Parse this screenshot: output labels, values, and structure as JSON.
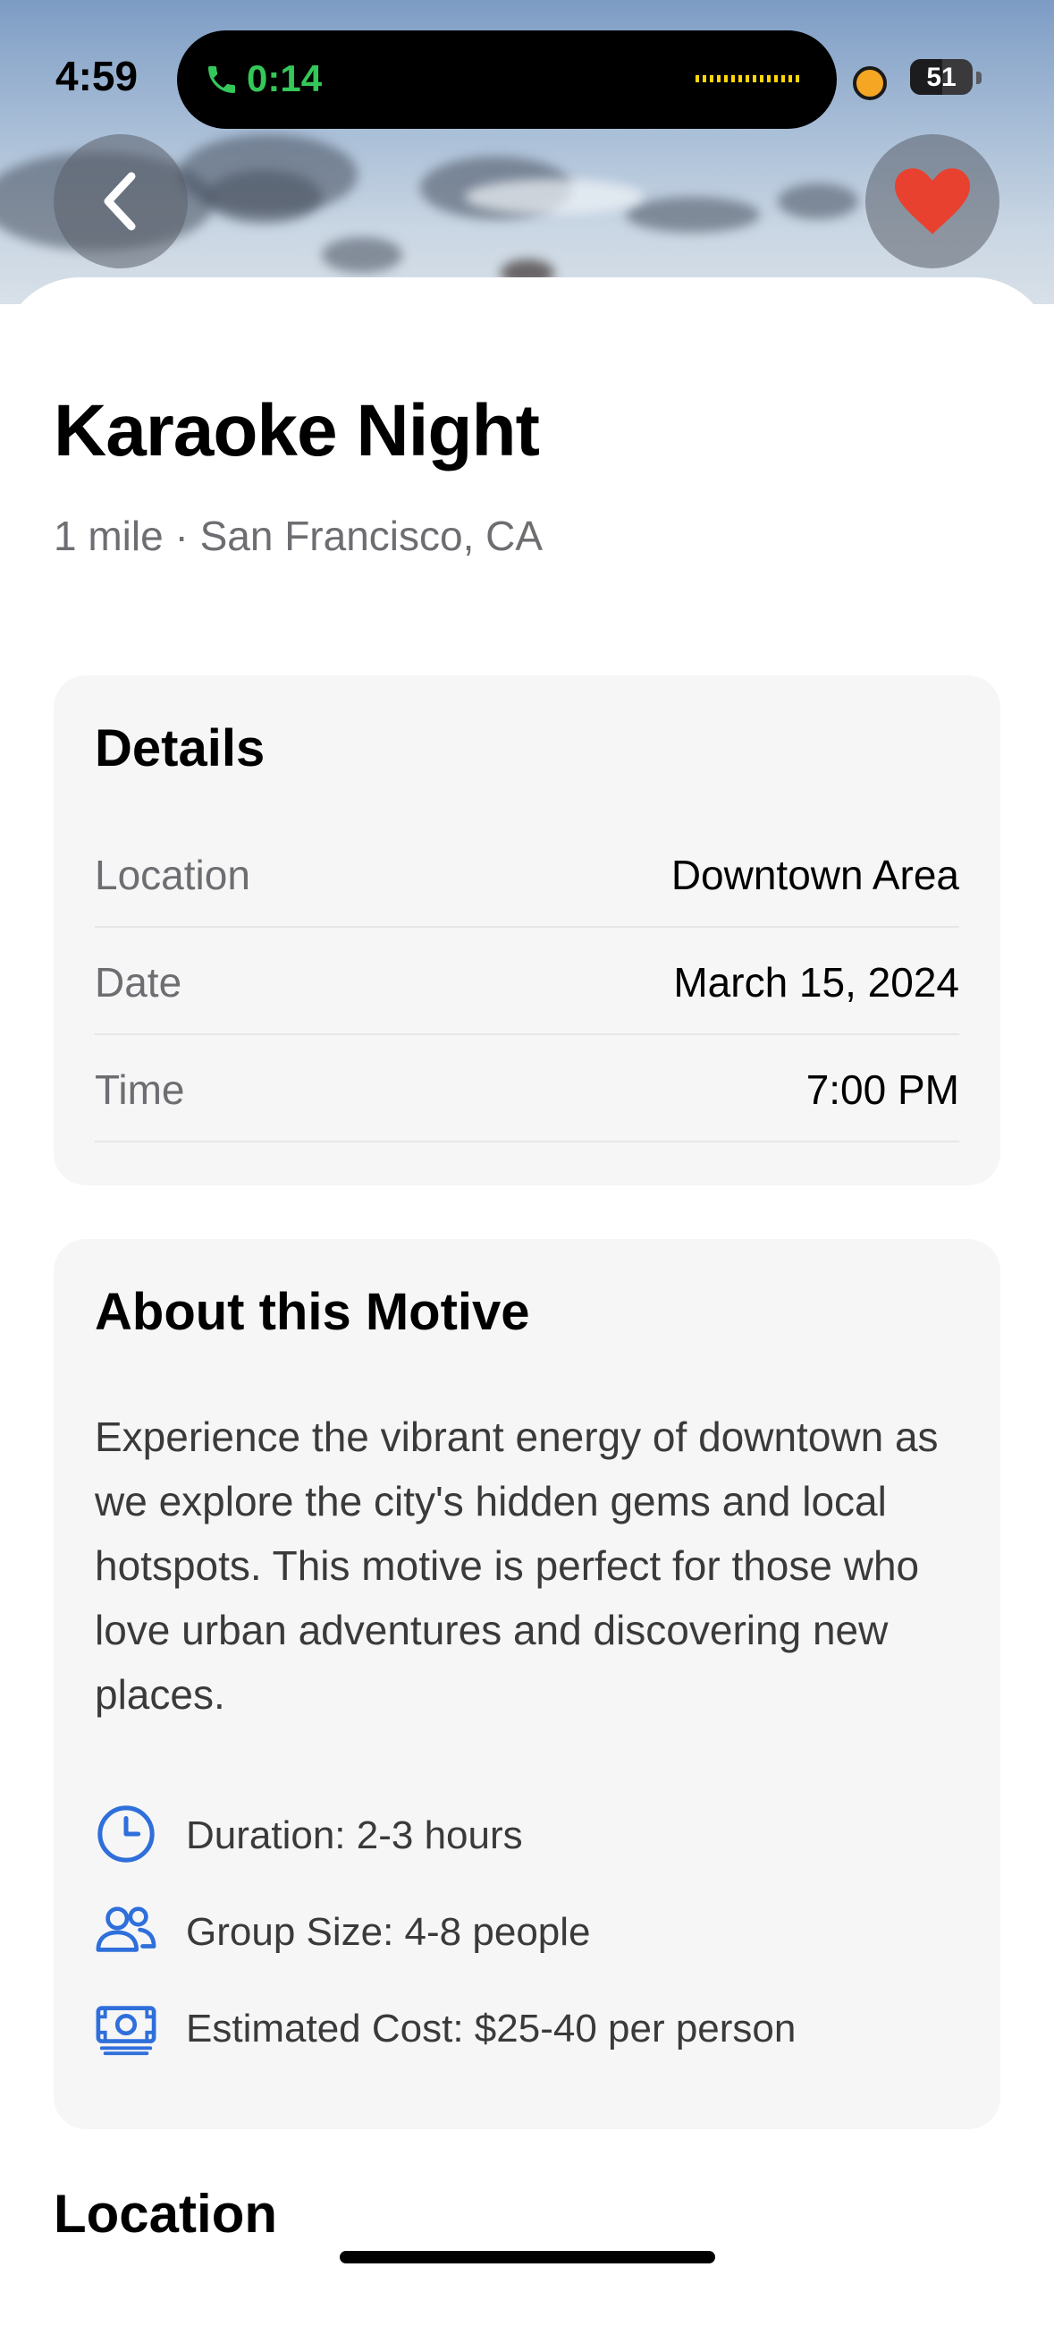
{
  "status_bar": {
    "time": "4:59",
    "call_timer": "0:14",
    "battery": "51",
    "battery_level": 0.51
  },
  "header": {
    "back_icon": "chevron-left-icon",
    "favorite_icon": "heart-icon",
    "favorite_color": "#e8412f"
  },
  "event": {
    "title": "Karaoke Night",
    "subtitle": "1 mile · San Francisco, CA"
  },
  "details": {
    "heading": "Details",
    "rows": [
      {
        "label": "Location",
        "value": "Downtown Area"
      },
      {
        "label": "Date",
        "value": "March 15, 2024"
      },
      {
        "label": "Time",
        "value": "7:00 PM"
      }
    ]
  },
  "about": {
    "heading": "About this Motive",
    "description": "Experience the vibrant energy of downtown as we explore the city's hidden gems and local hotspots. This motive is perfect for those who love urban adventures and discovering new places.",
    "meta": [
      {
        "icon": "clock-icon",
        "text": "Duration: 2-3 hours"
      },
      {
        "icon": "people-icon",
        "text": "Group Size: 4-8 people"
      },
      {
        "icon": "money-icon",
        "text": "Estimated Cost: $25-40 per person"
      }
    ],
    "accent_color": "#2f6fdb"
  },
  "location_section": {
    "heading": "Location"
  }
}
